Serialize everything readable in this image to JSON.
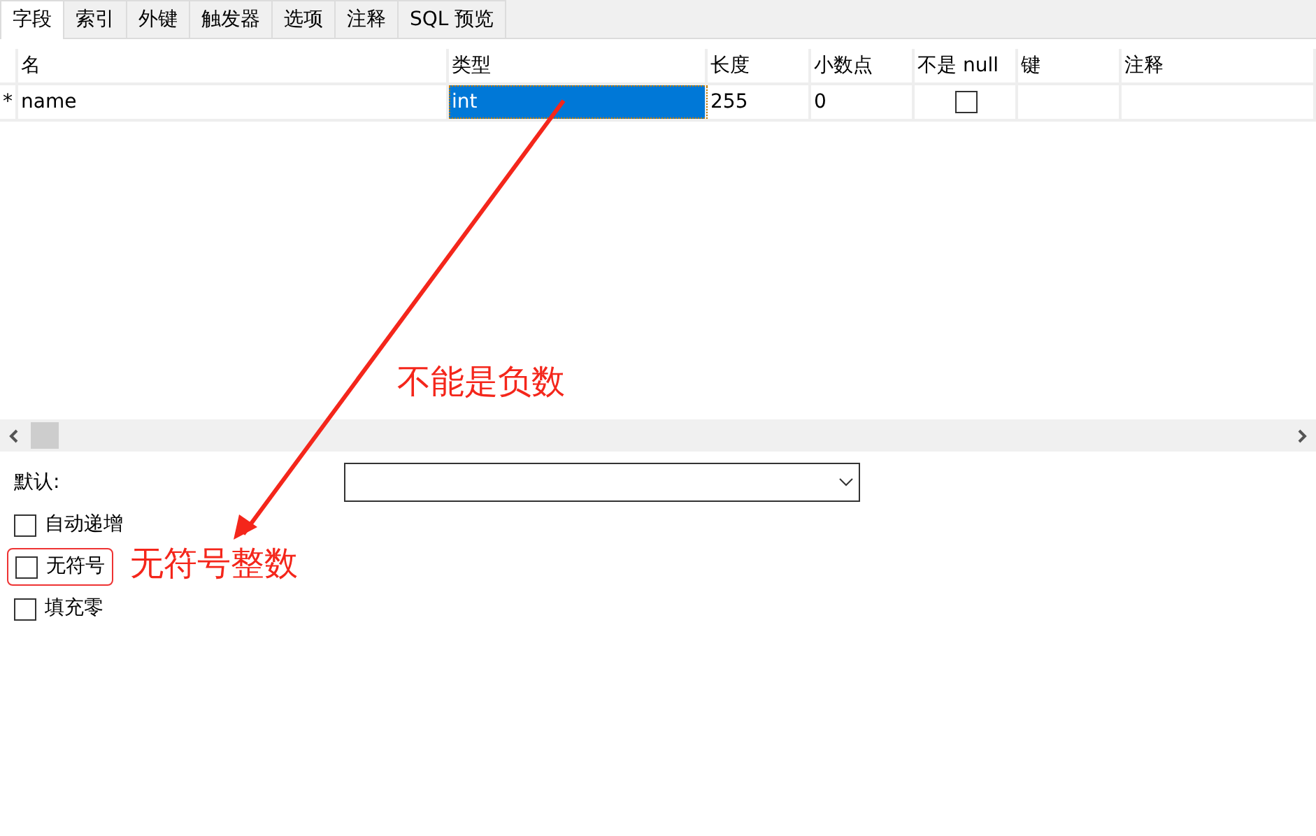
{
  "tabs": [
    {
      "label": "字段",
      "selected": true
    },
    {
      "label": "索引",
      "selected": false
    },
    {
      "label": "外键",
      "selected": false
    },
    {
      "label": "触发器",
      "selected": false
    },
    {
      "label": "选项",
      "selected": false
    },
    {
      "label": "注释",
      "selected": false
    },
    {
      "label": "SQL 预览",
      "selected": false
    }
  ],
  "table": {
    "columns": [
      "名",
      "类型",
      "长度",
      "小数点",
      "不是 null",
      "键",
      "注释"
    ],
    "rows": [
      {
        "marker": "*",
        "name": "name",
        "type": "int",
        "type_selected": true,
        "length": "255",
        "decimals": "0",
        "not_null": false
      }
    ]
  },
  "options": {
    "default_label": "默认:",
    "checkboxes": [
      {
        "label": "自动递增",
        "checked": false,
        "highlighted": false
      },
      {
        "label": "无符号",
        "checked": false,
        "highlighted": true
      },
      {
        "label": "填充零",
        "checked": false,
        "highlighted": false
      }
    ]
  },
  "annotations": [
    {
      "kind": "arrow-note",
      "text": "不能是负数"
    },
    {
      "kind": "box-note",
      "text": "无符号整数"
    }
  ]
}
